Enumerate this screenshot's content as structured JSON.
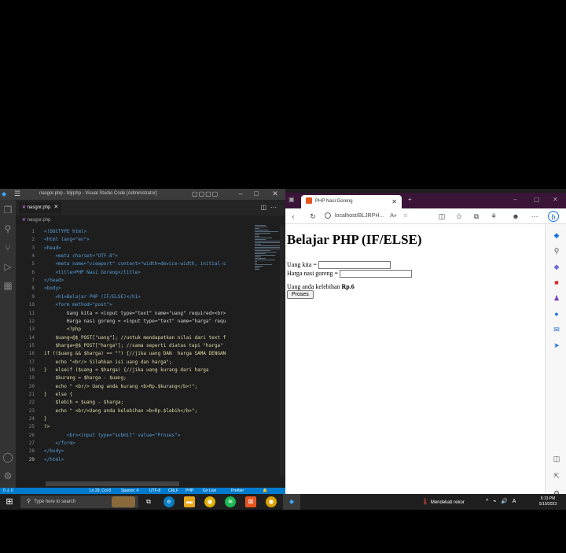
{
  "vscode": {
    "window_title": "nasgor.php - bljrphp - Visual Studio Code [Administrator]",
    "tab_label": "nasgor.php",
    "breadcrumb": "nasgor.php",
    "lines": [
      {
        "no": "1",
        "code": "<!DOCTYPE html>"
      },
      {
        "no": "2",
        "code": "<html lang=\"en\">"
      },
      {
        "no": "3",
        "code": "<head>"
      },
      {
        "no": "4",
        "code": "    <meta charset=\"UTF-8\">"
      },
      {
        "no": "5",
        "code": "    <meta name=\"viewport\" content=\"width=device-width, initial-s"
      },
      {
        "no": "6",
        "code": "    <title>PHP Nasi Goreng</title>"
      },
      {
        "no": "7",
        "code": "</head>"
      },
      {
        "no": "8",
        "code": "<body>"
      },
      {
        "no": "9",
        "code": "    <h1>Belajar PHP (IF/ELSE)</h1>"
      },
      {
        "no": "10",
        "code": "    <form method=\"post\">"
      },
      {
        "no": "11",
        "code": "        Uang kita = <input type=\"text\" name=\"uang\" required><br>"
      },
      {
        "no": "12",
        "code": "        Harga nasi goreng = <input type=\"text\" name=\"harga\" requ"
      },
      {
        "no": "13",
        "code": "        <?php"
      },
      {
        "no": "14",
        "code": "    $uang=@$_POST[\"uang\"]; //untuk mendapatkan nilai dari text f"
      },
      {
        "no": "15",
        "code": "    $harga=@$_POST[\"harga\"]; //sama seperti diatas tapi \"harga\""
      },
      {
        "no": "16",
        "code": "if (($uang && $harga) == \"\") {//jika uang DAN  harga SAMA DENGAN"
      },
      {
        "no": "17",
        "code": "    echo \"<br/> Silahkan isi uang dan harga\";"
      },
      {
        "no": "18",
        "code": "}   elseif ($uang < $harga) {//jika uang kurang dari harga"
      },
      {
        "no": "19",
        "code": "    $kurang = $harga - $uang;"
      },
      {
        "no": "20",
        "code": "    echo \" <br/> Uang anda kurang <b>Rp.$kurang</b>!\";"
      },
      {
        "no": "21",
        "code": "}   else {"
      },
      {
        "no": "22",
        "code": "    $lebih = $uang - $harga;"
      },
      {
        "no": "23",
        "code": "    echo \" <br/>Uang anda kelebihan <b>Rp.$lebih</b>\";"
      },
      {
        "no": "24",
        "code": "}"
      },
      {
        "no": "25",
        "code": "?>"
      },
      {
        "no": "26",
        "code": "        <br><input type=\"submit\" value=\"Proses\">"
      },
      {
        "no": "27",
        "code": "    </form>"
      },
      {
        "no": "28",
        "code": "</body>"
      },
      {
        "no": "29",
        "code": "</html>"
      }
    ],
    "status": {
      "position": "Ln 29, Col 8",
      "spaces": "Spaces: 4",
      "encoding": "UTF-8",
      "eol": "CRLF",
      "language": "PHP",
      "golive": "Go Live",
      "prettier": "Prettier",
      "problems": "0 ⚠ 0"
    }
  },
  "browser": {
    "tab_title": "PHP Nasi Goreng",
    "address": "localhost/BLJRPH...",
    "page": {
      "heading": "Belajar PHP (IF/ELSE)",
      "uang_label": "Uang kita =",
      "harga_label": "Harga nasi goreng =",
      "result_prefix": "Uang anda kelebihan ",
      "result_value": "Rp.6",
      "submit_label": "Proses"
    }
  },
  "taskbar": {
    "search_placeholder": "Type here to search",
    "weather": "Mendekati rekor",
    "time": "6:13 PM",
    "date": "5/10/2023"
  }
}
